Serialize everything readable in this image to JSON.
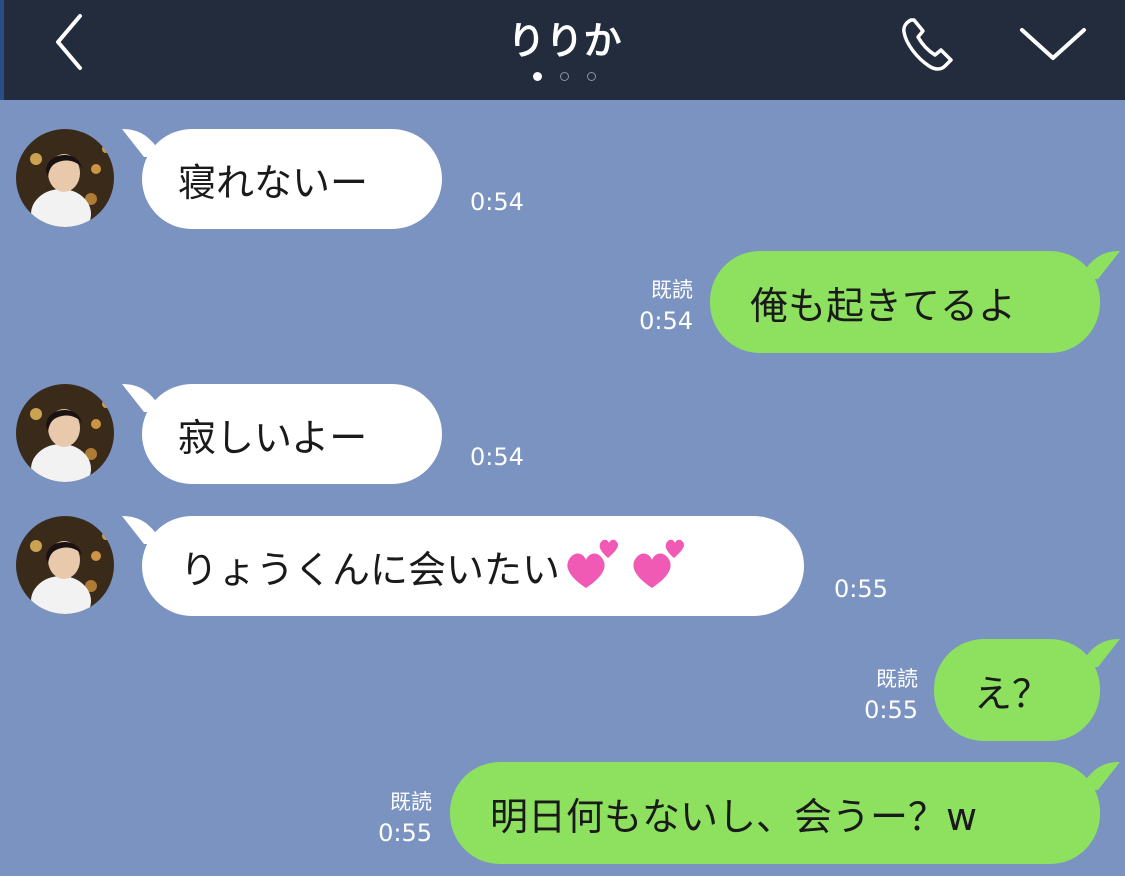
{
  "header": {
    "title": "りりか",
    "back_icon": "chevron-left-icon",
    "call_icon": "phone-icon",
    "menu_icon": "chevron-down-icon",
    "page_indicator": {
      "count": 3,
      "active": 1
    }
  },
  "colors": {
    "header_bg": "#222c3d",
    "chat_bg": "#7b93c1",
    "incoming_bubble": "#ffffff",
    "outgoing_bubble": "#8ee05f"
  },
  "messages": [
    {
      "direction": "in",
      "text": "寝れないー",
      "time": "0:54"
    },
    {
      "direction": "out",
      "text": "俺も起きてるよ",
      "read": "既読",
      "time": "0:54"
    },
    {
      "direction": "in",
      "text": "寂しいよー",
      "time": "0:54"
    },
    {
      "direction": "in",
      "text": "りょうくんに会いたい",
      "emoji": "two-hearts-icon",
      "time": "0:55"
    },
    {
      "direction": "out",
      "text": "え？",
      "read": "既読",
      "time": "0:55"
    },
    {
      "direction": "out",
      "text": "明日何もないし、会うー？w",
      "read": "既読",
      "time": "0:55"
    }
  ]
}
